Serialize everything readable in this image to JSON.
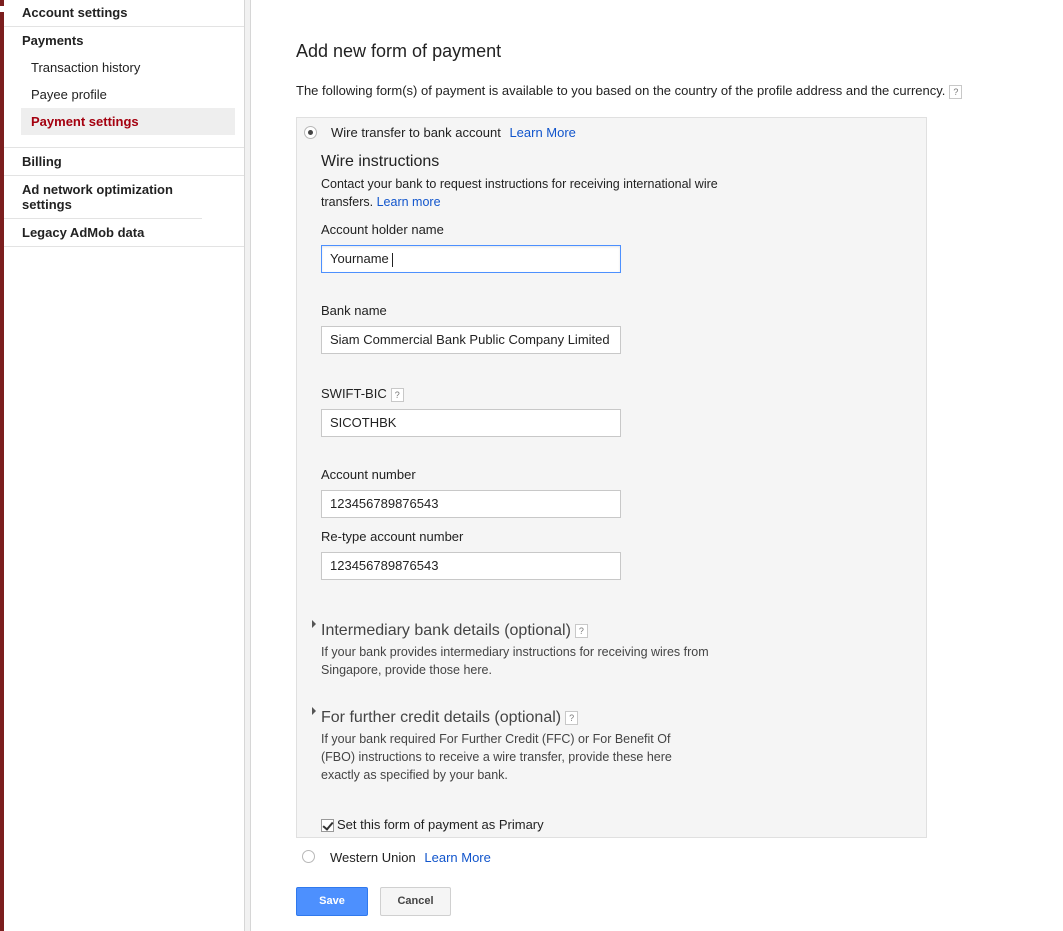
{
  "sidebar": {
    "account_settings": "Account settings",
    "payments": "Payments",
    "transaction_history": "Transaction history",
    "payee_profile": "Payee profile",
    "payment_settings": "Payment settings",
    "billing": "Billing",
    "ad_network_optimization": "Ad network optimization settings",
    "legacy_admob": "Legacy AdMob data"
  },
  "main": {
    "title": "Add new form of payment",
    "intro": "The following form(s) of payment is available to you based on the country of the profile address and the currency.",
    "help_glyph": "?",
    "wire_option": {
      "label": "Wire transfer to bank account",
      "learn_more": "Learn More"
    },
    "wire_instructions": {
      "title": "Wire instructions",
      "desc": "Contact your bank to request instructions for receiving international wire transfers.",
      "learn_more": "Learn more"
    },
    "fields": {
      "account_holder": {
        "label": "Account holder name",
        "value": "Yourname"
      },
      "bank_name": {
        "label": "Bank name",
        "value": "Siam Commercial Bank Public Company Limited"
      },
      "swift": {
        "label": "SWIFT-BIC",
        "value": "SICOTHBK"
      },
      "account_number": {
        "label": "Account number",
        "value": "123456789876543"
      },
      "retype_account": {
        "label": "Re-type account number",
        "value": "123456789876543"
      }
    },
    "intermediary": {
      "title": "Intermediary bank details (optional)",
      "desc": "If your bank provides intermediary instructions for receiving wires from Singapore, provide those here."
    },
    "further_credit": {
      "title": "For further credit details (optional)",
      "desc": "If your bank required For Further Credit (FFC) or For Benefit Of (FBO) instructions to receive a wire transfer, provide these here exactly as specified by your bank."
    },
    "primary_checkbox": {
      "label": "Set this form of payment as Primary",
      "checked": true
    },
    "western_union": {
      "label": "Western Union",
      "learn_more": "Learn More"
    },
    "save_button": "Save",
    "cancel_button": "Cancel"
  },
  "colors": {
    "accent": "#4d90fe",
    "link": "#1155cc",
    "active_nav": "#a4000f",
    "left_strip": "#7b1e1e"
  }
}
